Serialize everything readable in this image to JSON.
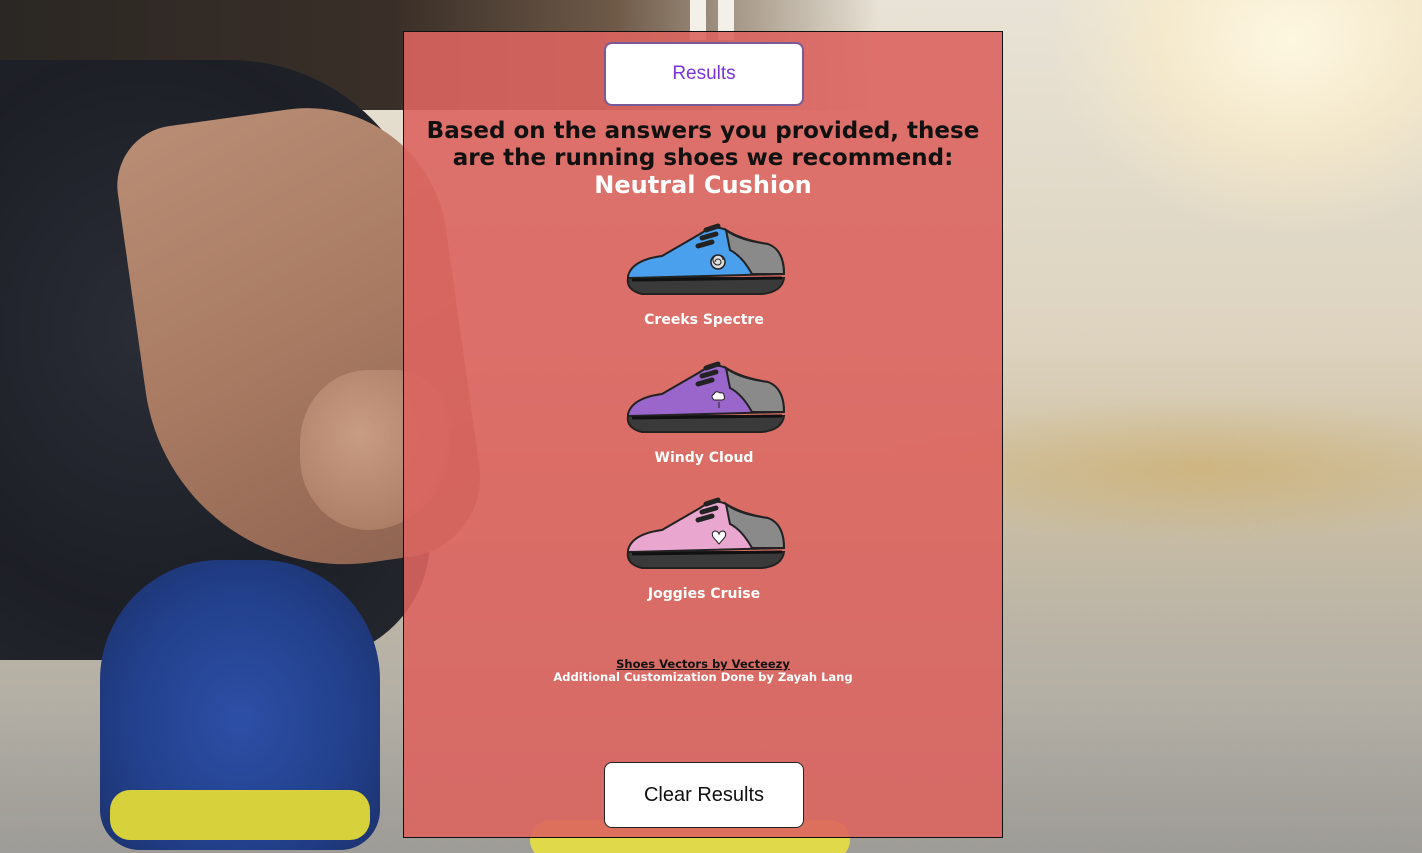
{
  "page": {
    "title_button_label": "Results",
    "intro_text": "Based on the answers you provided, these are the running shoes we recommend:",
    "category": "Neutral Cushion"
  },
  "shoes": [
    {
      "name": "Creeks Spectre",
      "color": "#4aa0ec",
      "badge": "spiral"
    },
    {
      "name": "Windy Cloud",
      "color": "#9a66cc",
      "badge": "cloud"
    },
    {
      "name": "Joggies Cruise",
      "color": "#e9a6cf",
      "badge": "heart"
    }
  ],
  "credits": {
    "link_text": "Shoes Vectors by Vecteezy",
    "note": "Additional Customization Done by Zayah Lang"
  },
  "actions": {
    "clear_label": "Clear Results"
  },
  "colors": {
    "card_bg": "#dc645f",
    "title_text": "#7b34d6"
  }
}
